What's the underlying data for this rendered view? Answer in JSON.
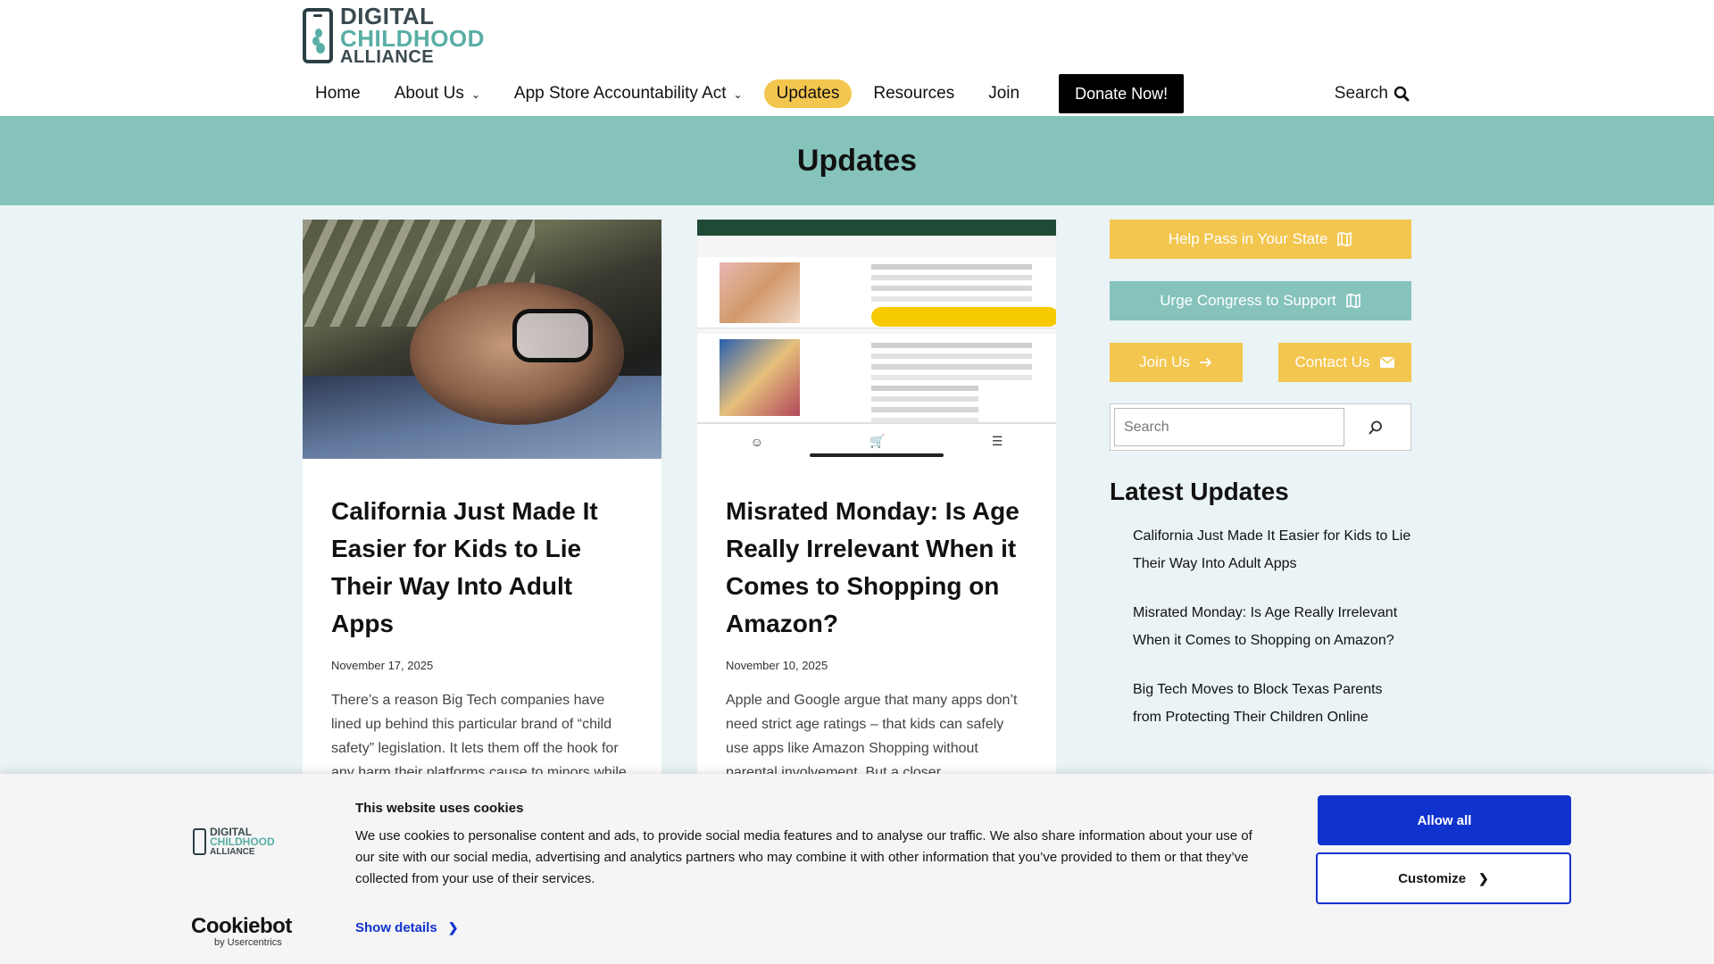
{
  "logo": {
    "line1": "DIGITAL",
    "line2": "CHILDHOOD",
    "line3": "ALLIANCE"
  },
  "nav": {
    "items": [
      {
        "label": "Home"
      },
      {
        "label": "About Us"
      },
      {
        "label": "App Store Accountability Act"
      },
      {
        "label": "Updates"
      },
      {
        "label": "Resources"
      },
      {
        "label": "Join"
      }
    ],
    "donate_label": "Donate Now!",
    "search_label": "Search"
  },
  "page": {
    "title": "Updates"
  },
  "posts": [
    {
      "title": "California Just Made It Easier for Kids to Lie Their Way Into Adult Apps",
      "date": "November 17, 2025",
      "excerpt": "There’s a reason Big Tech companies have lined up behind this particular brand of “child safety” legislation. It lets them off the hook for any harm their platforms cause to minors while putting the entire burden of"
    },
    {
      "title": "Misrated Monday: Is Age Really Irrelevant When it Comes to Shopping on Amazon?",
      "date": "November 10, 2025",
      "excerpt": "Apple and Google argue that many apps don’t need strict age ratings – that kids can safely use apps like Amazon Shopping without parental involvement. But a closer"
    }
  ],
  "sidebar": {
    "help_label": "Help Pass in Your State",
    "urge_label": "Urge Congress to Support",
    "join_label": "Join Us",
    "contact_label": "Contact Us",
    "search_placeholder": "Search",
    "latest_title": "Latest Updates",
    "latest": [
      "California Just Made It Easier for Kids to Lie Their Way Into Adult Apps",
      "Misrated Monday: Is Age Really Irrelevant When it Comes to Shopping on Amazon?",
      "Big Tech Moves to Block Texas Parents from Protecting Their Children Online"
    ]
  },
  "cookie": {
    "heading": "This website uses cookies",
    "text": "We use cookies to personalise content and ads, to provide social media features and to analyse our traffic. We also share information about your use of our site with our social media, advertising and analytics partners who may combine it with other information that you’ve provided to them or that they’ve collected from your use of their services.",
    "show_details": "Show details",
    "allow_all": "Allow all",
    "customize": "Customize",
    "brand": "Cookiebot",
    "brand_sub": "by Usercentrics"
  },
  "colors": {
    "accent_yellow": "#f3c64f",
    "accent_teal": "#85c3bb",
    "cookie_blue": "#1032cf"
  }
}
